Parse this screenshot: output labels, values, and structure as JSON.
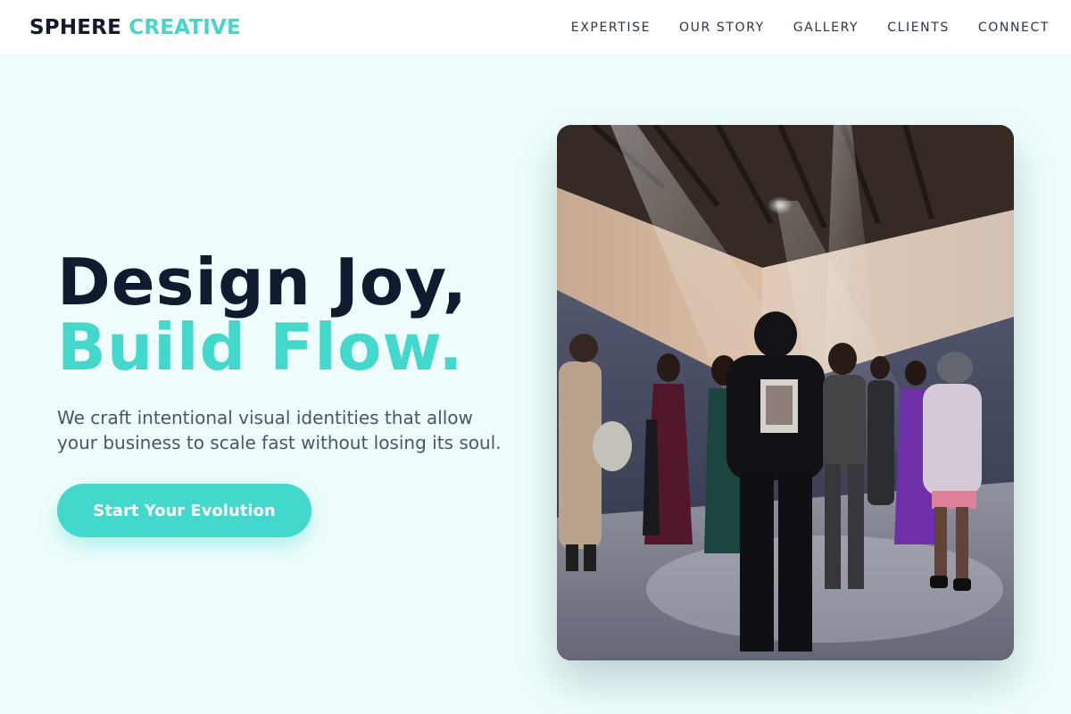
{
  "brand": {
    "name_part1": "SPHERE",
    "name_part2": "CREATIVE"
  },
  "nav": {
    "items": [
      {
        "label": "EXPERTISE"
      },
      {
        "label": "OUR STORY"
      },
      {
        "label": "GALLERY"
      },
      {
        "label": "CLIENTS"
      },
      {
        "label": "CONNECT"
      }
    ]
  },
  "hero": {
    "headline_line1": "Design Joy,",
    "headline_line2": "Build Flow.",
    "subtitle": "We craft intentional visual identities that allow your business to scale fast without losing its soul.",
    "cta_label": "Start Your Evolution",
    "image_icon": "event-photo-image"
  },
  "colors": {
    "accent": "#42d9cc",
    "dark": "#111a2e",
    "background": "#effdfd"
  }
}
